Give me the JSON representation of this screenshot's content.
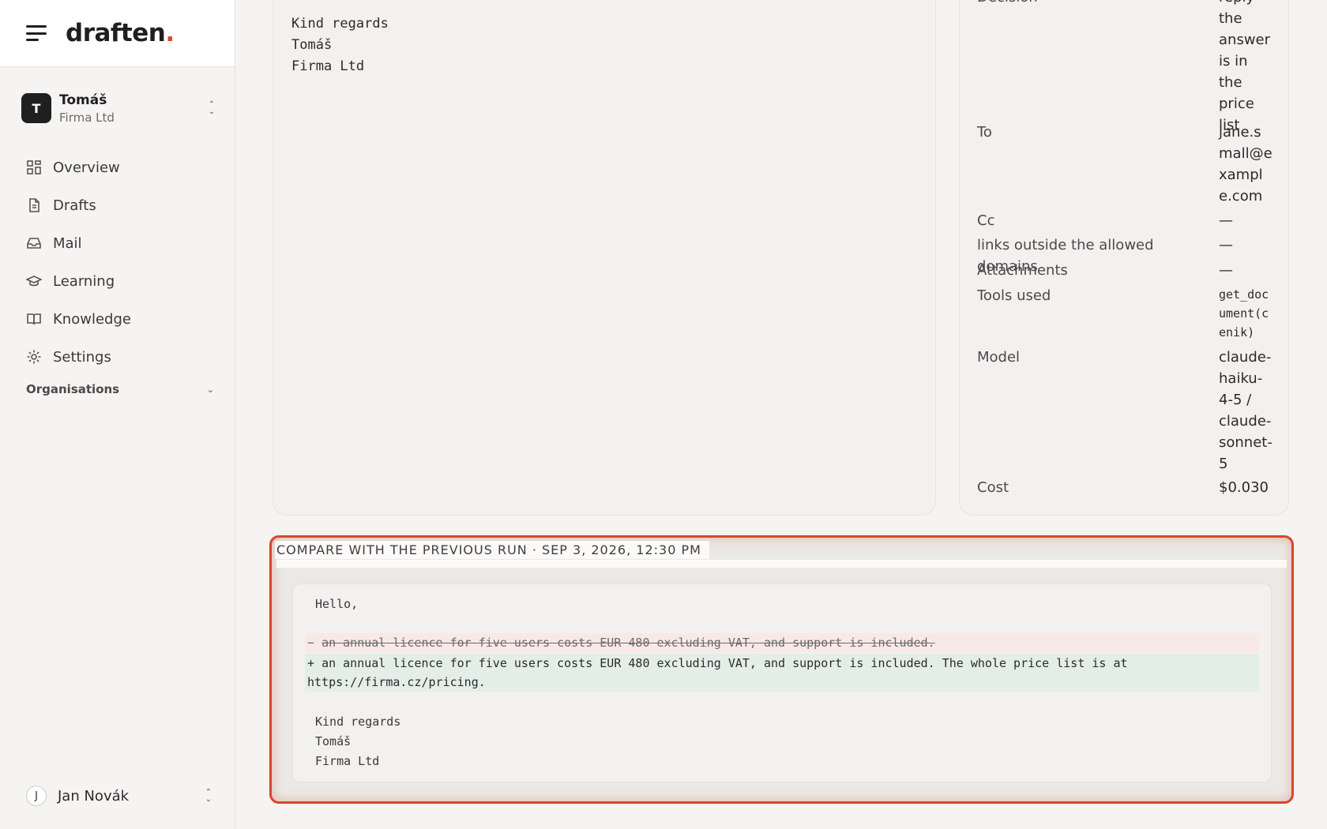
{
  "brand": {
    "name": "draften",
    "dot": "."
  },
  "account": {
    "initial": "T",
    "name": "Tomáš",
    "org": "Firma Ltd"
  },
  "nav": [
    {
      "label": "Overview",
      "icon": "grid-icon"
    },
    {
      "label": "Drafts",
      "icon": "document-icon"
    },
    {
      "label": "Mail",
      "icon": "inbox-icon"
    },
    {
      "label": "Learning",
      "icon": "graduation-cap-icon"
    },
    {
      "label": "Knowledge",
      "icon": "book-icon"
    },
    {
      "label": "Settings",
      "icon": "gear-icon"
    }
  ],
  "organisations": {
    "label": "Organisations"
  },
  "user": {
    "initial": "J",
    "name": "Jan Novák"
  },
  "email": {
    "signoff": "Kind regards",
    "name": "Tomáš",
    "company": "Firma Ltd"
  },
  "meta": {
    "decision_key": "Decision",
    "decision_val": "reply the answer is in the price list",
    "to_key": "To",
    "to_val": "jane.small@example.com",
    "cc_key": "Cc",
    "cc_val": "—",
    "links_key": "links outside the allowed domains",
    "links_val": "—",
    "attachments_key": "Attachments",
    "attachments_val": "—",
    "tools_key": "Tools used",
    "tools_val": "get_document(cenik)",
    "model_key": "Model",
    "model_val": "claude-haiku-4-5 / claude-sonnet-5",
    "cost_key": "Cost",
    "cost_val": "$0.030"
  },
  "compare": {
    "title": "COMPARE WITH THE PREVIOUS RUN · SEP 3, 2026, 12:30 PM",
    "greeting": "Hello,",
    "del_marker": "−",
    "del_text": "an annual licence for five users costs EUR 480 excluding VAT, and support is included.",
    "add_marker": "+",
    "add_text_1": "an annual licence for five users costs EUR 480 excluding VAT, and support is included. The whole price list is at",
    "add_text_2": "https://firma.cz/pricing.",
    "signoff": "Kind regards",
    "name": "Tomáš",
    "company": "Firma Ltd"
  }
}
